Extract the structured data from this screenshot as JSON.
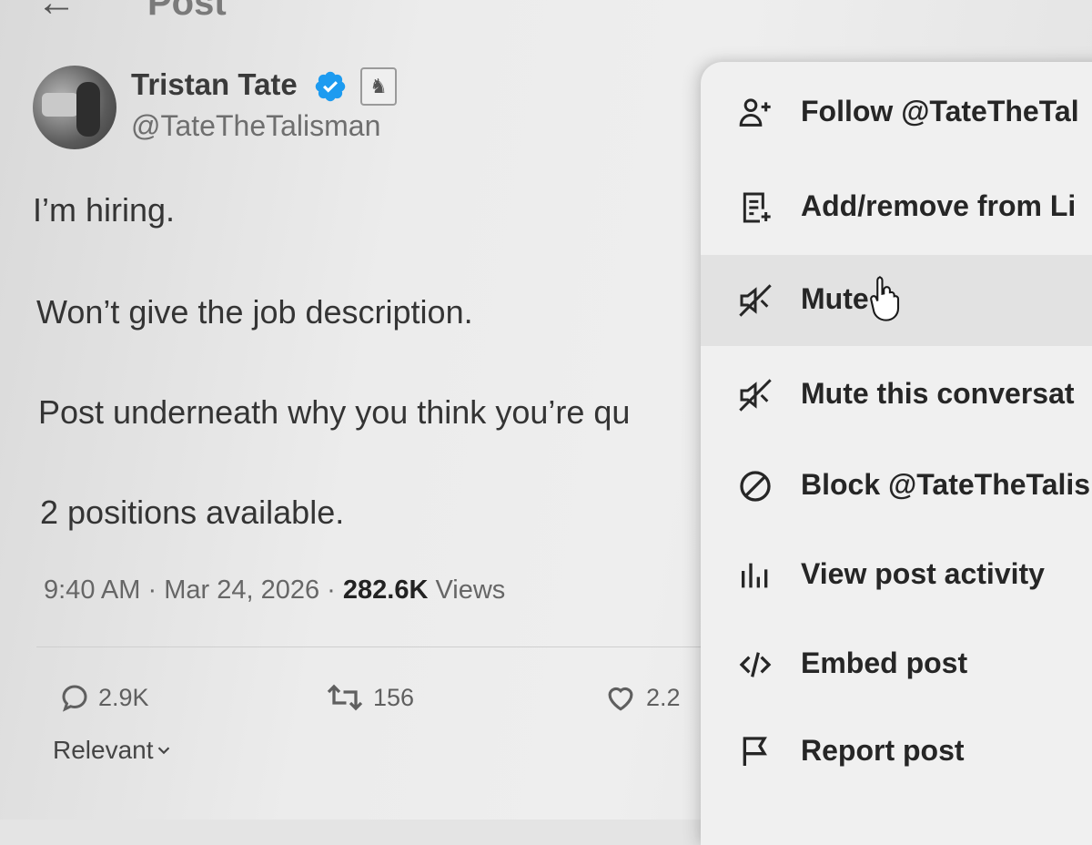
{
  "header": {
    "title": "Post"
  },
  "author": {
    "name": "Tristan Tate",
    "handle": "@TateTheTalisman",
    "affiliate_badge_glyph": "♞"
  },
  "post": {
    "lines": [
      "I’m hiring.",
      "Won’t give the job description.",
      "Post underneath why you think you’re qu",
      "2 positions available."
    ],
    "time": "9:40 AM",
    "date": "Mar 24, 2026",
    "separator": "·",
    "views_count": "282.6K",
    "views_label": "Views"
  },
  "actions": {
    "replies": "2.9K",
    "reposts": "156",
    "likes": "2.2"
  },
  "sort": {
    "label": "Relevant"
  },
  "menu": {
    "items": [
      {
        "label": "Follow @TateTheTal",
        "icon": "follow-user-icon"
      },
      {
        "label": "Add/remove from Li",
        "icon": "list-add-icon"
      },
      {
        "label": "Mute",
        "icon": "mute-icon",
        "hovered": true
      },
      {
        "label": "Mute this conversat",
        "icon": "mute-icon"
      },
      {
        "label": "Block @TateTheTalis",
        "icon": "block-icon"
      },
      {
        "label": "View post activity",
        "icon": "activity-icon"
      },
      {
        "label": "Embed post",
        "icon": "code-icon"
      },
      {
        "label": "Report post",
        "icon": "flag-icon"
      }
    ]
  },
  "colors": {
    "verified": "#1d9bf0",
    "hover_bg": "#e2e2e2"
  }
}
